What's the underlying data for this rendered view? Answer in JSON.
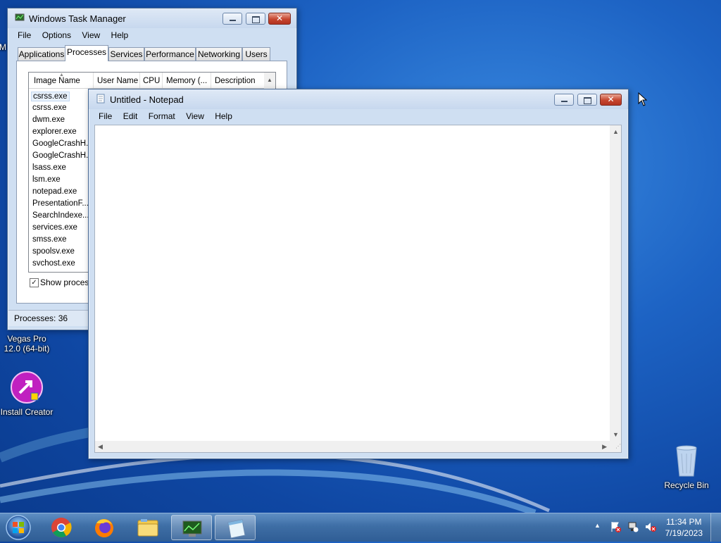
{
  "desktop": {
    "icons": [
      {
        "label_line1": "Vegas Pro",
        "label_line2": "12.0 (64-bit)",
        "icon": "vegas-pro-icon"
      },
      {
        "label": "Install Creator",
        "icon": "install-creator-icon"
      },
      {
        "label": "Recycle Bin",
        "icon": "recycle-bin-icon"
      }
    ],
    "partial_label": "M"
  },
  "task_manager": {
    "title": "Windows Task Manager",
    "menu": [
      "File",
      "Options",
      "View",
      "Help"
    ],
    "tabs": [
      "Applications",
      "Processes",
      "Services",
      "Performance",
      "Networking",
      "Users"
    ],
    "active_tab": "Processes",
    "columns": [
      "Image Name",
      "User Name",
      "CPU",
      "Memory (...",
      "Description"
    ],
    "processes": [
      "csrss.exe",
      "csrss.exe",
      "dwm.exe",
      "explorer.exe",
      "GoogleCrashH...",
      "GoogleCrashH...",
      "lsass.exe",
      "lsm.exe",
      "notepad.exe",
      "PresentationF...",
      "SearchIndexe...",
      "services.exe",
      "smss.exe",
      "spoolsv.exe",
      "svchost.exe"
    ],
    "selected_process_index": 0,
    "show_processes_label": "Show processe",
    "show_processes_checked": true,
    "status": "Processes: 36"
  },
  "notepad": {
    "title": "Untitled - Notepad",
    "menu": [
      "File",
      "Edit",
      "Format",
      "View",
      "Help"
    ],
    "content": ""
  },
  "taskbar": {
    "pinned": [
      "start-orb-icon",
      "chrome-icon",
      "firefox-icon",
      "file-explorer-icon",
      "task-manager-icon",
      "notepad-icon"
    ],
    "clock_time": "11:34 PM",
    "clock_date": "7/19/2023",
    "tray_icons": [
      "show-hidden-icons-icon",
      "action-center-icon",
      "network-icon",
      "volume-muted-icon"
    ]
  },
  "colors": {
    "desktop_blue": "#1d63c4",
    "window_frame": "#cfdff2",
    "close_red": "#c6462f",
    "taskbar": "#3e6ea5"
  }
}
